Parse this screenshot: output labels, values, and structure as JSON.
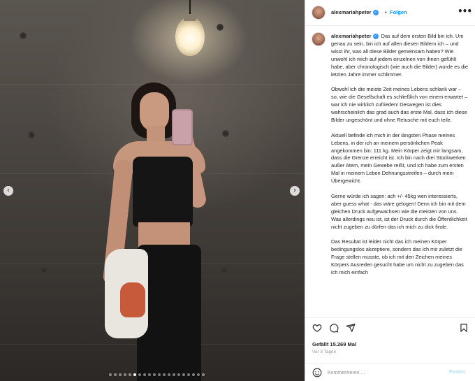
{
  "post": {
    "username": "alexmariahpeter",
    "follow_label": "Folgen",
    "separator": "•",
    "more_glyph": "•••",
    "verified_glyph": "✓"
  },
  "caption": {
    "paragraphs": [
      "Das auf dem ersten Bild bin ich. Um genau zu sein, bin ich auf allen diesen Bildern ich – und wisst ihr, was all diese Bilder gemeinsam haben? Wie unwohl ich mich auf jedem einzelnen von ihnen gefühlt habe, aber chronologisch (wie auch die Bilder) wurde es die letzten Jahre immer schlimmer.",
      "Obwohl ich die meiste Zeit meines Lebens schlank war – so, wie die Gesellschaft es schließlich von einem erwartet – war ich nie wirklich zufrieden! Deswegen ist dies wahrscheinlich das grad auch das erste Mal, dass ich diese Bilder ungeschönt und ohne Retusche mit euch teile.",
      "Aktuell befinde ich mich in der längsten Phase meines Lebens, in der ich an meinem persönlichen Peak angekommen bin: 111 kg. Mein Körper zeigt mir langsam, dass die Grenze erreicht ist. Ich bin nach drei Stockwerken außer Atem, mein Gewebe reißt, und ich habe zum ersten Mal in meinem Leben Dehnungsstreifen – durch mein Übergewicht.",
      "Gerne würde ich sagen: ach +/- 45kg wen interessierts, aber guess what - das wäre gelogen! Denn ich bin mit dem gleichen Druck aufgewachsen wie die meisten von uns. Was allerdings neu ist, ist der Druck durch die Öffentlichkeit nicht zugeben zu dürfen das ich mich zu dick finde.",
      "Das Resultat ist leider nicht das ich meinen Körper bedingungslos akzeptiere, sondern das ich mir zuletzt die Frage stellen musste, ob ich mit den Zeichen meines Körpers Ausreden gesucht habe um nicht zu zugeben das ich mich einfach"
    ]
  },
  "stats": {
    "likes": "Gefällt 15.269 Mal",
    "time": "Vor 3 Tagen"
  },
  "comment": {
    "placeholder": "Kommentieren ...",
    "post_label": "Posten"
  },
  "carousel": {
    "count": 20,
    "active_index": 5,
    "prev_glyph": "‹",
    "next_glyph": "›"
  },
  "colors": {
    "link_blue": "#0095f6",
    "verified_blue": "#3897f0",
    "post_disabled": "#b2dffc"
  },
  "icons": [
    "heart-icon",
    "comment-icon",
    "share-icon",
    "bookmark-icon",
    "emoji-icon",
    "more-icon",
    "verified-icon"
  ]
}
